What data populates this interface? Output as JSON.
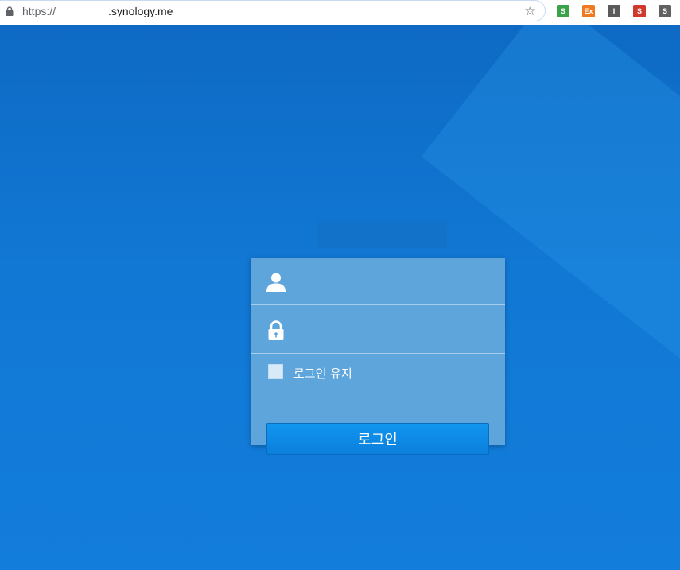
{
  "browser": {
    "url_prefix": "https://",
    "url_host": ".synology.me",
    "extensions": [
      {
        "name": "ext-s-green",
        "label": "S",
        "color": "#3aa34a"
      },
      {
        "name": "ext-ex",
        "label": "Ex",
        "color": "#f07a22"
      },
      {
        "name": "ext-i",
        "label": "I",
        "color": "#5a5a5a"
      },
      {
        "name": "ext-s-red",
        "label": "S",
        "color": "#d2392d"
      },
      {
        "name": "ext-s-gray",
        "label": "S",
        "color": "#616161"
      }
    ]
  },
  "login": {
    "username_value": "",
    "password_value": "",
    "remember_label": "로그인 유지",
    "login_button": "로그인"
  },
  "colors": {
    "background": "#1172cc",
    "card": "#5ea5dc",
    "button": "#0b86e6"
  }
}
